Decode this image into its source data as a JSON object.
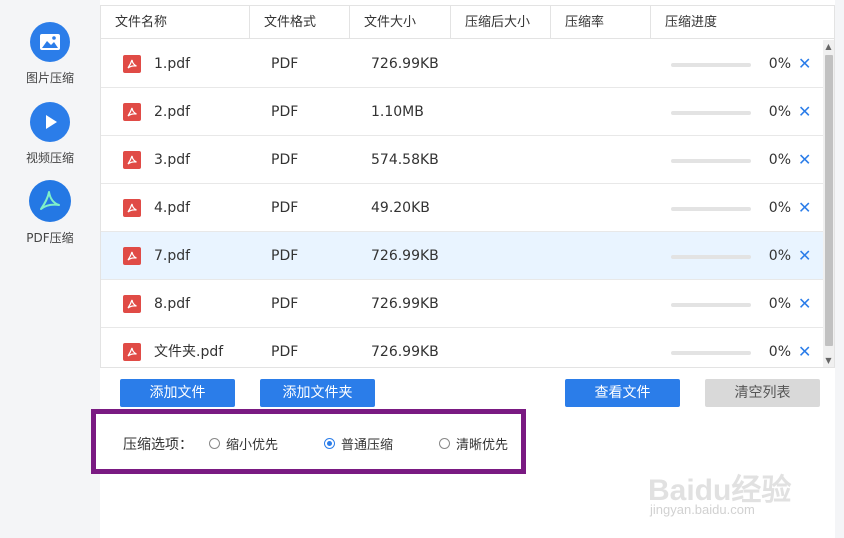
{
  "sidebar": {
    "items": [
      {
        "label": "图片压缩",
        "icon": "image-icon"
      },
      {
        "label": "视频压缩",
        "icon": "play-icon"
      },
      {
        "label": "PDF压缩",
        "icon": "pdf-icon"
      }
    ]
  },
  "table": {
    "headers": [
      "文件名称",
      "文件格式",
      "文件大小",
      "压缩后大小",
      "压缩率",
      "压缩进度"
    ],
    "rows": [
      {
        "name": "1.pdf",
        "format": "PDF",
        "size": "726.99KB",
        "progress": "0%"
      },
      {
        "name": "2.pdf",
        "format": "PDF",
        "size": "1.10MB",
        "progress": "0%"
      },
      {
        "name": "3.pdf",
        "format": "PDF",
        "size": "574.58KB",
        "progress": "0%"
      },
      {
        "name": "4.pdf",
        "format": "PDF",
        "size": "49.20KB",
        "progress": "0%"
      },
      {
        "name": "7.pdf",
        "format": "PDF",
        "size": "726.99KB",
        "progress": "0%"
      },
      {
        "name": "8.pdf",
        "format": "PDF",
        "size": "726.99KB",
        "progress": "0%"
      },
      {
        "name": "文件夹.pdf",
        "format": "PDF",
        "size": "726.99KB",
        "progress": "0%"
      }
    ],
    "selected_row": 4
  },
  "buttons": {
    "add_file": "添加文件",
    "add_folder": "添加文件夹",
    "view_files": "查看文件",
    "clear_list": "清空列表"
  },
  "options": {
    "label": "压缩选项：",
    "choices": [
      "缩小优先",
      "普通压缩",
      "清晰优先"
    ],
    "selected": "普通压缩"
  },
  "watermark": {
    "text": "Baidu经验",
    "url": "jingyan.baidu.com"
  },
  "colors": {
    "accent": "#2b7de9",
    "pdf_red": "#e04b46",
    "highlight_box": "#7a1a82",
    "selected_row": "#e9f4ff"
  }
}
